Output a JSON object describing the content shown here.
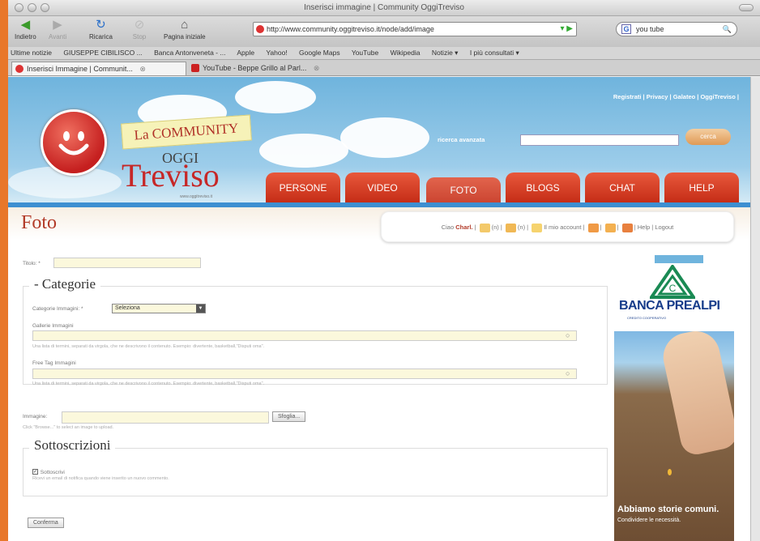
{
  "window": {
    "title": "Inserisci immagine | Community OggiTreviso"
  },
  "toolbar": {
    "back": "Indietro",
    "forward": "Avanti",
    "reload": "Ricarica",
    "stop": "Stop",
    "home": "Pagina iniziale",
    "url": "http://www.community.oggitreviso.it/node/add/image",
    "search_value": "you tube"
  },
  "bookmarks": [
    "Ultime notizie",
    "GIUSEPPE CIBILISCO ...",
    "Banca Antonveneta - ...",
    "Apple",
    "Yahoo!",
    "Google Maps",
    "YouTube",
    "Wikipedia",
    "Notizie ▾",
    "I più consultati ▾"
  ],
  "tabs": [
    {
      "label": "Inserisci Immagine | Communit..."
    },
    {
      "label": "YouTube - Beppe Grillo al Parl..."
    }
  ],
  "header": {
    "toplinks": "Registrati  |  Privacy  |  Galateo  |  OggiTreviso  |",
    "search_label": "ricerca avanzata",
    "search_button": "cerca",
    "logo_community": "La COMMUNITY",
    "logo_oggi": "OGGI",
    "logo_treviso": "Treviso",
    "logo_url": "www.oggitreviso.it",
    "nav": [
      "PERSONE",
      "VIDEO",
      "FOTO",
      "BLOGS",
      "CHAT",
      "HELP"
    ]
  },
  "page": {
    "title": "Foto",
    "userbox": {
      "greeting": "Ciao",
      "user": "Charl.",
      "count1": "(n)",
      "count2": "(n)",
      "my_friends": "Il mio account",
      "help": "Help",
      "logout": "Logout"
    }
  },
  "form": {
    "title_label": "Titolo: *",
    "categories_legend": "Categorie",
    "category_label": "Categorie Immagini: *",
    "category_value": "Seleziona",
    "gallery_label": "Gallerie Immagini",
    "gallery_hint": "Una lista di termini, separati da virgola, che ne descrivono il contenuto. Esempio: divertente, basketball,\"Disputi oma\".",
    "freetag_label": "Free Tag Immagini",
    "freetag_hint": "Una lista di termini, separati da virgola, che ne descrivono il contenuto. Esempio: divertente, basketball,\"Disputi oma\".",
    "image_label": "Immagine:",
    "browse_button": "Sfoglia...",
    "image_hint": "Click \"Browse...\" to select an image to upload.",
    "subs_legend": "Sottoscrizioni",
    "subscribe_label": "Sottoscrivi",
    "subscribe_hint": "Ricevi un email di notifica quando viene inserito un nuovo commento.",
    "submit": "Conferma"
  },
  "ad": {
    "brand": "BANCA PREALPI",
    "brand_sub": "CREDITO COOPERATIVO",
    "headline": "Abbiamo storie comuni.",
    "subline": "Condividere le necessità."
  }
}
